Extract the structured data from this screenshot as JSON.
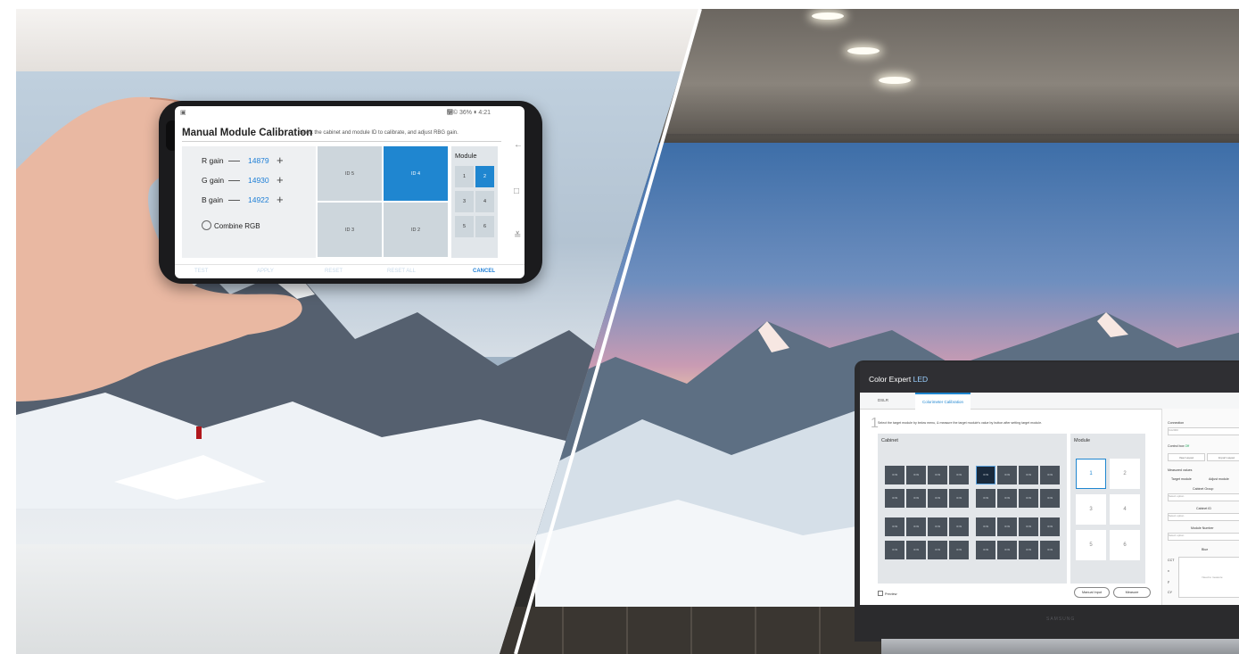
{
  "phone_app": {
    "title": "Manual Module Calibration",
    "description": "Select the cabinet and module ID to calibrate, and adjust RBG gain.",
    "status_bar": "᛽© 36% ▮ 4:21",
    "gains": [
      {
        "label": "R gain",
        "value": "14879"
      },
      {
        "label": "G gain",
        "value": "14930"
      },
      {
        "label": "B gain",
        "value": "14922"
      }
    ],
    "combine_rgb_label": "Combine RGB",
    "cabinets": [
      "ID 5",
      "ID 4",
      "ID 3",
      "ID 2"
    ],
    "selected_cabinet": "ID 4",
    "module_title": "Module",
    "modules": [
      "1",
      "2",
      "3",
      "4",
      "5",
      "6"
    ],
    "selected_module": "2",
    "footer_buttons": [
      "TEST",
      "APPLY",
      "RESET",
      "RESET ALL",
      "CANCEL"
    ],
    "active_footer_button": "CANCEL",
    "nav_icons": [
      "back-icon",
      "home-icon",
      "recent-apps-icon"
    ],
    "accent_color": "#1f86d0"
  },
  "laptop_app": {
    "title_prefix": "Color Expert",
    "title_suffix": "LED",
    "tabs": [
      "DSLR",
      "Colorimeter Calibration"
    ],
    "active_tab": "Colorimeter Calibration",
    "step_number": "1",
    "instruction": "Select the target module by below menu, & measure the target module's value by button after setting target module.",
    "cabinet_panel_title": "Cabinet",
    "module_panel_title": "Module",
    "modules": [
      "1",
      "2",
      "3",
      "4",
      "5",
      "6"
    ],
    "selected_module": "1",
    "cabinet_label": "ID 99",
    "preview_label": "Preview",
    "manual_input_label": "Manual Input",
    "measure_label": "Measure",
    "side": {
      "connection_label": "Connection",
      "connection_value": "CA2000",
      "control_box_label": "Control box",
      "control_box_status": "Off",
      "view_layout": "View Layout",
      "import_layout": "Import Layout",
      "measured_values": "Measured values",
      "target_module": "Target module",
      "adjust_module": "Adjust module",
      "cabinet_group": "Cabinet Group",
      "cabinet_id": "Cabinet ID",
      "module_number": "Module Number",
      "blue": "Blue",
      "select_option": "Select option",
      "need_to_measure": "Need to measure",
      "cct": "CCT",
      "x": "x",
      "y": "y",
      "luminance": "CY"
    },
    "brand": "SAMSUNG"
  }
}
